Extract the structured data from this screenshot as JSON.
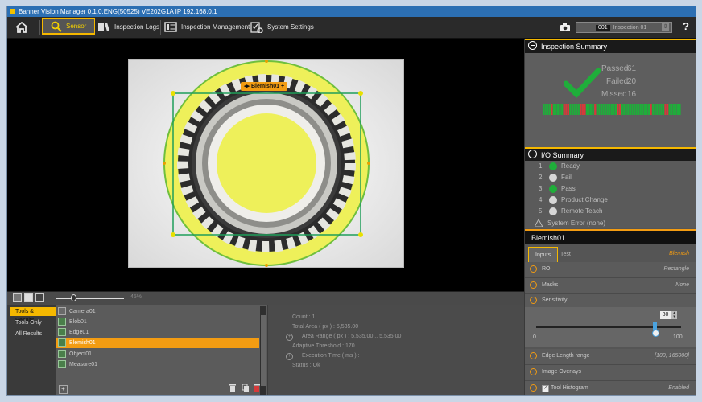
{
  "app_title": "Banner Vision Manager 0.1.0.ENG(50525) VE202G1A  IP 192.168.0.1",
  "nav": {
    "tabs": [
      {
        "label": "Sensor"
      },
      {
        "label": "Inspection Logs"
      },
      {
        "label": "Inspection Management"
      },
      {
        "label": "System Settings"
      }
    ],
    "inspection_number": "001",
    "inspection_name": "Inspection 01",
    "help": "?"
  },
  "viewer": {
    "tool_label": "Blemish01",
    "zoom_value": "45%"
  },
  "filters": [
    "Tools & Results",
    "Tools Only",
    "All Results"
  ],
  "tools": [
    "Camera01",
    "Blob01",
    "Edge01",
    "Blemish01",
    "Object01",
    "Measure01"
  ],
  "results": {
    "count": "Count :  1",
    "total_area": "Total Area ( px ) :  5,535.00",
    "area_range": "Area Range ( px ) :  5,535.00 .. 5,535.00",
    "adaptive_threshold": "Adaptive Threshold :  170",
    "execution_time": "Execution Time ( ms ) :",
    "status": "Status :  Ok"
  },
  "inspection_summary": {
    "title": "Inspection Summary",
    "passed_label": "Passed",
    "passed": "61",
    "failed_label": "Failed",
    "failed": "20",
    "missed_label": "Missed",
    "missed": "16",
    "history_pattern": "GGGGRGGGGGRRRGGGGGRRRGGGGRGGGGGGGGGGRRGGGGGGGGGGGGGGRGGGGGGRRGGGGGG"
  },
  "io_summary": {
    "title": "I/O Summary",
    "items": [
      {
        "num": "1",
        "label": "Ready",
        "state": "on"
      },
      {
        "num": "2",
        "label": "Fail",
        "state": "off"
      },
      {
        "num": "3",
        "label": "Pass",
        "state": "on"
      },
      {
        "num": "4",
        "label": "Product Change",
        "state": "off"
      },
      {
        "num": "5",
        "label": "Remote Teach",
        "state": "off"
      }
    ],
    "system_error": "System Error (none)"
  },
  "tool_panel": {
    "title": "Blemish01",
    "tab_inputs": "Inputs",
    "tab_test": "Test",
    "tool_type": "Blemish",
    "roi_label": "ROI",
    "roi_value": "Rectangle",
    "masks_label": "Masks",
    "masks_value": "None",
    "sensitivity_label": "Sensitivity",
    "sensitivity_value": "80",
    "slider_min": "0",
    "slider_max": "100",
    "edge_label": "Edge Length range",
    "edge_value": "[100, 165000]",
    "overlays_label": "Image Overlays",
    "histogram_label": "Tool Histogram",
    "histogram_value": "Enabled"
  },
  "colors": {
    "accent": "#f5b800",
    "selection": "#f39c12",
    "pass_green": "#1fae3a",
    "fail_red": "#d63a3a"
  }
}
